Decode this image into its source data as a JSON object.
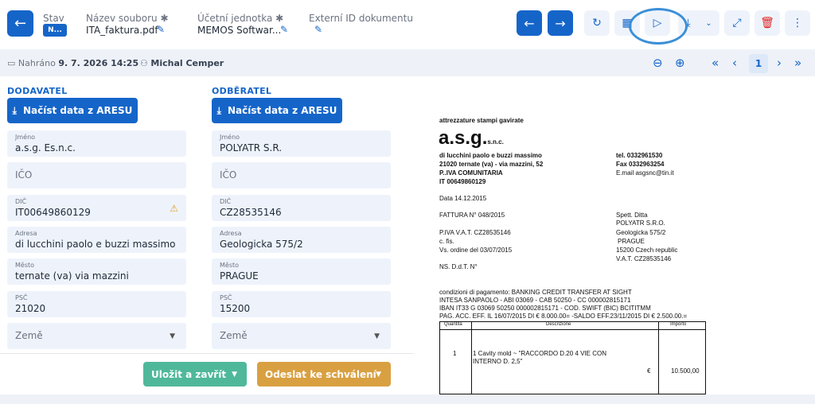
{
  "header": {
    "status_label": "Stav",
    "status_value": "N...",
    "filename_label": "Název souboru ✱",
    "filename_value": "ITA_faktura.pdf",
    "unit_label": "Účetní jednotka ✱",
    "unit_value": "MEMOS Softwar...",
    "extid_label": "Externí ID dokumentu"
  },
  "meta": {
    "uploaded_label": "Nahráno",
    "uploaded_value": "9. 7. 2026 14:25",
    "user": "Michal Cemper"
  },
  "pager": {
    "page": "1"
  },
  "supplier": {
    "title": "DODAVATEL",
    "ares_button": "Načíst data z ARESU",
    "name_label": "Jméno",
    "name_value": "a.s.g. Es.n.c.",
    "ico_placeholder": "IČO",
    "dic_label": "DIČ",
    "dic_value": "IT00649860129",
    "address_label": "Adresa",
    "address_value": "di lucchini paolo e buzzi massimo",
    "city_label": "Město",
    "city_value": "ternate (va) via mazzini",
    "zip_label": "PSČ",
    "zip_value": "21020",
    "country_placeholder": "Země"
  },
  "customer": {
    "title": "ODBĚRATEL",
    "ares_button": "Načíst data z ARESU",
    "name_label": "Jméno",
    "name_value": "POLYATR S.R.",
    "ico_placeholder": "IČO",
    "dic_label": "DIČ",
    "dic_value": "CZ28535146",
    "address_label": "Adresa",
    "address_value": "Geologicka 575/2",
    "city_label": "Město",
    "city_value": "PRAGUE",
    "zip_label": "PSČ",
    "zip_value": "15200",
    "country_placeholder": "Země"
  },
  "actions": {
    "save_close": "Uložit a zavřít",
    "send_approval": "Odeslat ke schválení"
  },
  "colors": {
    "primary": "#1565c9",
    "save": "#4fb89a",
    "send": "#d9a041",
    "danger": "#e02424",
    "highlight": "#3a8fd8"
  },
  "document": {
    "company_line": "attrezzature stampi gavirate",
    "logo": "a.s.g.",
    "logo_suffix": "s.n.c.",
    "owners": "di lucchini paolo e buzzi massimo",
    "address": "21020 ternate (va) - via mazzini, 52",
    "piva_comm": "P..IVA COMUNITARIA",
    "it_code": "IT 00649860129",
    "tel": "tel. 0332961530",
    "fax": "Fax  0332963254",
    "email": "E.mail asgsnc@tin.it",
    "date": "Data 14.12.2015",
    "invoice": "FATTURA N° 048/2015",
    "spett": "Spett. Ditta",
    "cust_name": "POLYATR S.R.O.",
    "piva_vat": "P.IVA V.A.T. CZ28535146",
    "cust_street": "Geologicka 575/2",
    "cfis": "c. fis.",
    "cust_city": "PRAGUE",
    "order": "Vs. ordine del 03/07/2015",
    "cust_zip": "15200 Czech republic",
    "cust_vat": "V.A.T. CZ28535146",
    "ddt": "NS. D.d.T. N°",
    "pay1": "condizioni di pagamento: BANKING CREDIT TRANSFER AT SIGHT",
    "pay2": "INTESA SANPAOLO - ABI 03069 - CAB 50250 - CC 000002815171",
    "pay3": "IBAN IT33 G 03069 50250 000002815171 - COD. SWIFT (BIC) BCITITMM",
    "pay4": "PAG. ACC. EFF. IL 16/07/2015 DI € 8.000.00= -SALDO EFF.23/11/2015 DI € 2.500.00.=",
    "col_qty": "Quantità",
    "col_desc": "Descrizione",
    "col_amount": "Importo",
    "row_qty": "1",
    "row_desc1": "1 Cavity  mold ~ \"RACCORDO D.20 4 VIE CON",
    "row_desc2": "INTERNO D. 2,5\"",
    "row_cur": "€",
    "row_amount": "10.500,00"
  }
}
